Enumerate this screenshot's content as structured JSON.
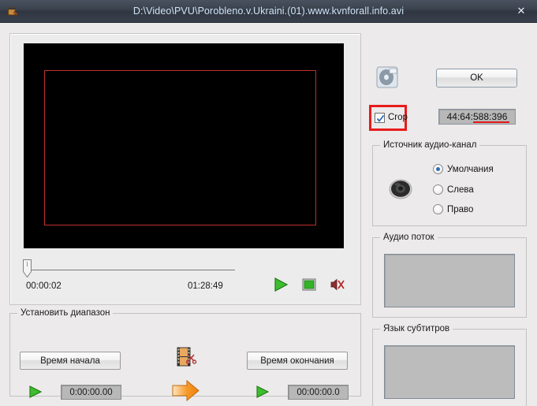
{
  "window": {
    "title": "D:\\Video\\PVU\\Porobleno.v.Ukraini.(01).www.kvnforall.info.avi",
    "close_label": "✕",
    "app_icon": "film-clapper-icon"
  },
  "preview": {
    "time_current": "00:00:02",
    "time_total": "01:28:49",
    "play_icon": "play-icon",
    "stop_icon": "stop-icon",
    "mute_icon": "mute-icon",
    "slider_icon": "slider-thumb-icon"
  },
  "range_group": {
    "title": "Установить диапазон",
    "start_button": "Время начала",
    "end_button": "Время окончания",
    "start_value": "0:00:00.00",
    "end_value": "00:00:00.0",
    "film_cut_icon": "film-scissors-icon",
    "arrow_icon": "orange-arrow-icon",
    "start_play_icon": "play-icon",
    "end_play_icon": "play-icon"
  },
  "right_panel": {
    "dvd_icon": "dvd-disc-icon",
    "ok_label": "OK",
    "crop_label": "Crop",
    "crop_checked": true,
    "dimensions_value": "44:64:588:396"
  },
  "audio_source_group": {
    "title": "Источник аудио-канал",
    "speaker_icon": "speaker-icon",
    "options": [
      {
        "label": "Умолчания",
        "selected": true
      },
      {
        "label": "Слева",
        "selected": false
      },
      {
        "label": "Право",
        "selected": false
      }
    ]
  },
  "audio_stream_group": {
    "title": "Аудио поток"
  },
  "subtitles_group": {
    "title": "Язык субтитров"
  },
  "colors": {
    "titlebar": "#3b424e",
    "title_text": "#cfe3f5",
    "crop_highlight": "#e81b1b",
    "crop_rect": "#c03030",
    "accent_green": "#2aa320",
    "accent_orange": "#f08a1e"
  }
}
